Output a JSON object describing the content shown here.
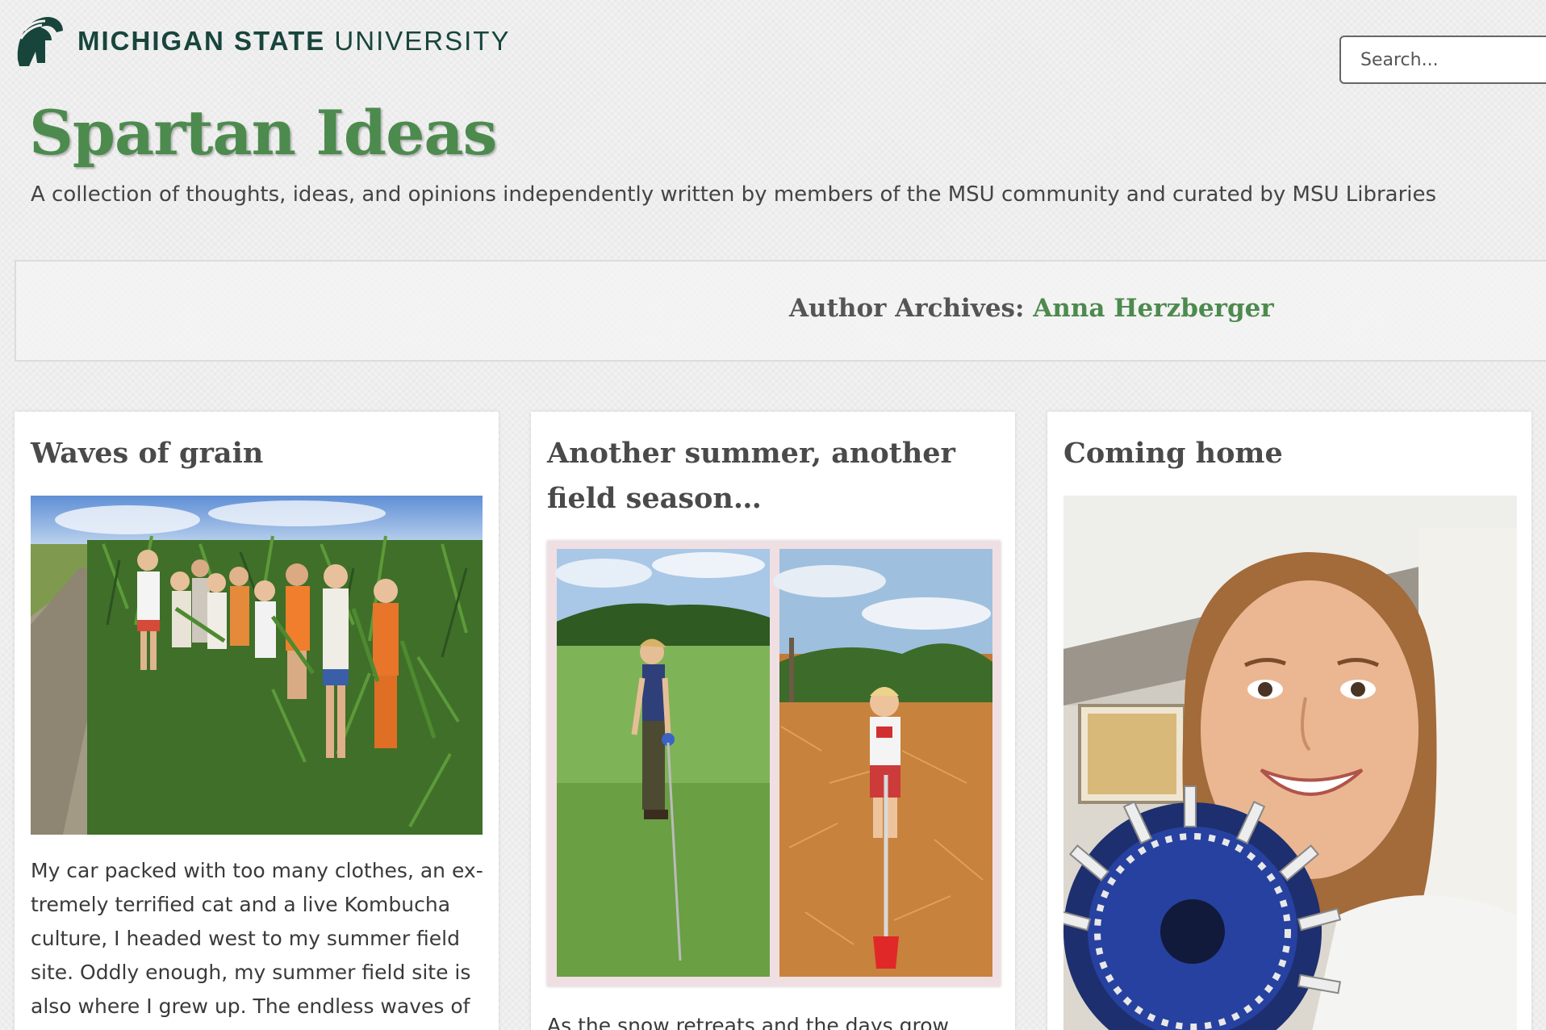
{
  "header": {
    "logo_bold": "MICHIGAN STATE",
    "logo_light": " UNIVERSITY",
    "logo_icon": "spartan-helmet-icon",
    "search_placeholder": "Search..."
  },
  "site": {
    "title": "Spartan Ideas",
    "description": "A collection of thoughts, ideas, and opinions independently written by members of the MSU community and curated by MSU Libraries"
  },
  "archive": {
    "label": "Author Archives: ",
    "author": "Anna Herzberger"
  },
  "posts": [
    {
      "title": "Waves of grain",
      "excerpt": "My car packed with too many clothes, an ex­tremely terrified cat and a live Kombucha cul­ture, I headed west to my summer field site. Oddly enough, my summer field site is also where I grew up. The endless waves of grain"
    },
    {
      "title": "Another summer, another field season…",
      "excerpt": "As the snow retreats and the days grow longer"
    },
    {
      "title": "Coming home",
      "excerpt": ""
    }
  ],
  "colors": {
    "brand_green": "#18453b",
    "title_green": "#4d8a4e"
  }
}
